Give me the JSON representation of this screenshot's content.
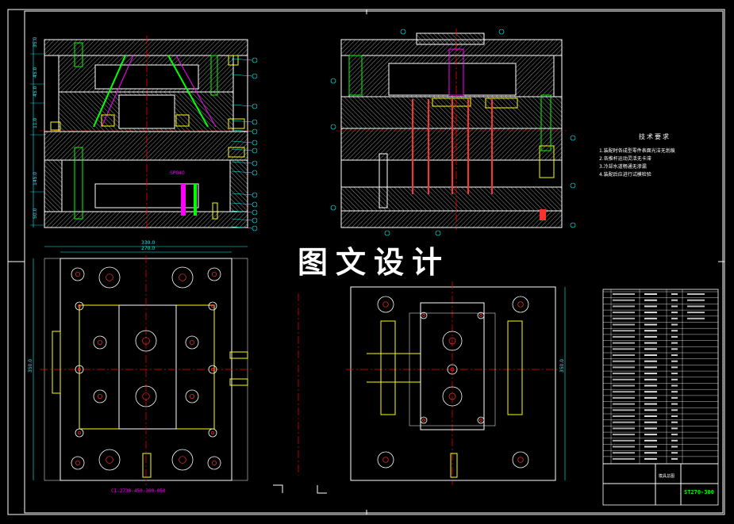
{
  "watermark": "图文设计",
  "tech_requirements": {
    "title": "技术要求",
    "lines": [
      "1.装配时各成型零件表面光洁无划痕",
      "2.各推杆运动灵活无卡滞",
      "3.冷却水道畅通无渗漏",
      "4.装配后应进行试模检验"
    ]
  },
  "dimensions": {
    "front_section": [
      "35.0",
      "45.0",
      "45.0",
      "11.0",
      "145.0",
      "50.0",
      "25.0"
    ],
    "plan_width_outer": "330.0",
    "plan_width_inner": "270.0",
    "plan_height_left": "350.0",
    "plan_height_right": "350.0",
    "spacer_note": "SP040"
  },
  "bottom_note": "CI-2730-450-300-050",
  "title_block": {
    "drawing_no": "ST270-300",
    "name": "模具总图"
  },
  "colors": {
    "background": "#000000",
    "outline": "#ffffff",
    "hatch": "#ffffff",
    "centerline": "#ff0000",
    "dimension": "#00ffff",
    "part_green": "#00ff00",
    "part_yellow": "#ffff00",
    "part_magenta": "#ff00ff",
    "part_red": "#ff3030"
  }
}
